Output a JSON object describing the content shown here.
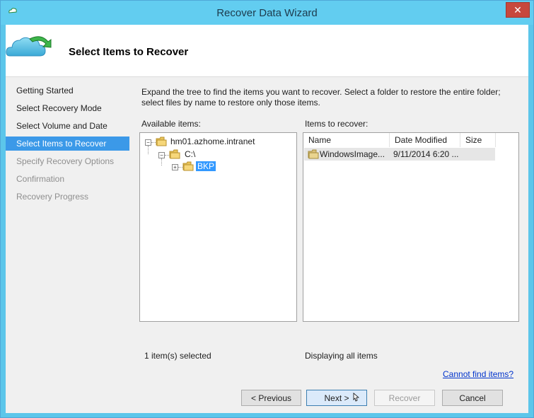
{
  "window": {
    "title": "Recover Data Wizard",
    "close_glyph": "✕"
  },
  "header": {
    "title": "Select Items to Recover",
    "icon": "cloud-recover-icon"
  },
  "sidebar": {
    "steps": [
      {
        "label": "Getting Started",
        "state": "done"
      },
      {
        "label": "Select Recovery Mode",
        "state": "done"
      },
      {
        "label": "Select Volume and Date",
        "state": "done"
      },
      {
        "label": "Select Items to Recover",
        "state": "active"
      },
      {
        "label": "Specify Recovery Options",
        "state": "disabled"
      },
      {
        "label": "Confirmation",
        "state": "disabled"
      },
      {
        "label": "Recovery Progress",
        "state": "disabled"
      }
    ]
  },
  "main": {
    "instructions": "Expand the tree to find the items you want to recover. Select a folder to restore the entire folder; select files by name to restore only those items.",
    "available_label": "Available items:",
    "recover_label": "Items to recover:",
    "tree": [
      {
        "label": "hm01.azhome.intranet",
        "expander": "−"
      },
      {
        "label": "C:\\",
        "expander": "−"
      },
      {
        "label": "BKP",
        "expander": "+",
        "selected": true
      }
    ],
    "columns": [
      "Name",
      "Date Modified",
      "Size"
    ],
    "rows": [
      {
        "name": "WindowsImage...",
        "date": "9/11/2014 6:20 ...",
        "size": ""
      }
    ],
    "selected_status": "1 item(s) selected",
    "display_status": "Displaying all items",
    "cannot_find_link": "Cannot find items?"
  },
  "buttons": {
    "previous": "< Previous",
    "next": "Next >",
    "recover": "Recover",
    "cancel": "Cancel"
  },
  "colors": {
    "titlebar": "#62cdf0",
    "active_step": "#3b99e8",
    "selection": "#3399ff",
    "link": "#0033cc"
  }
}
